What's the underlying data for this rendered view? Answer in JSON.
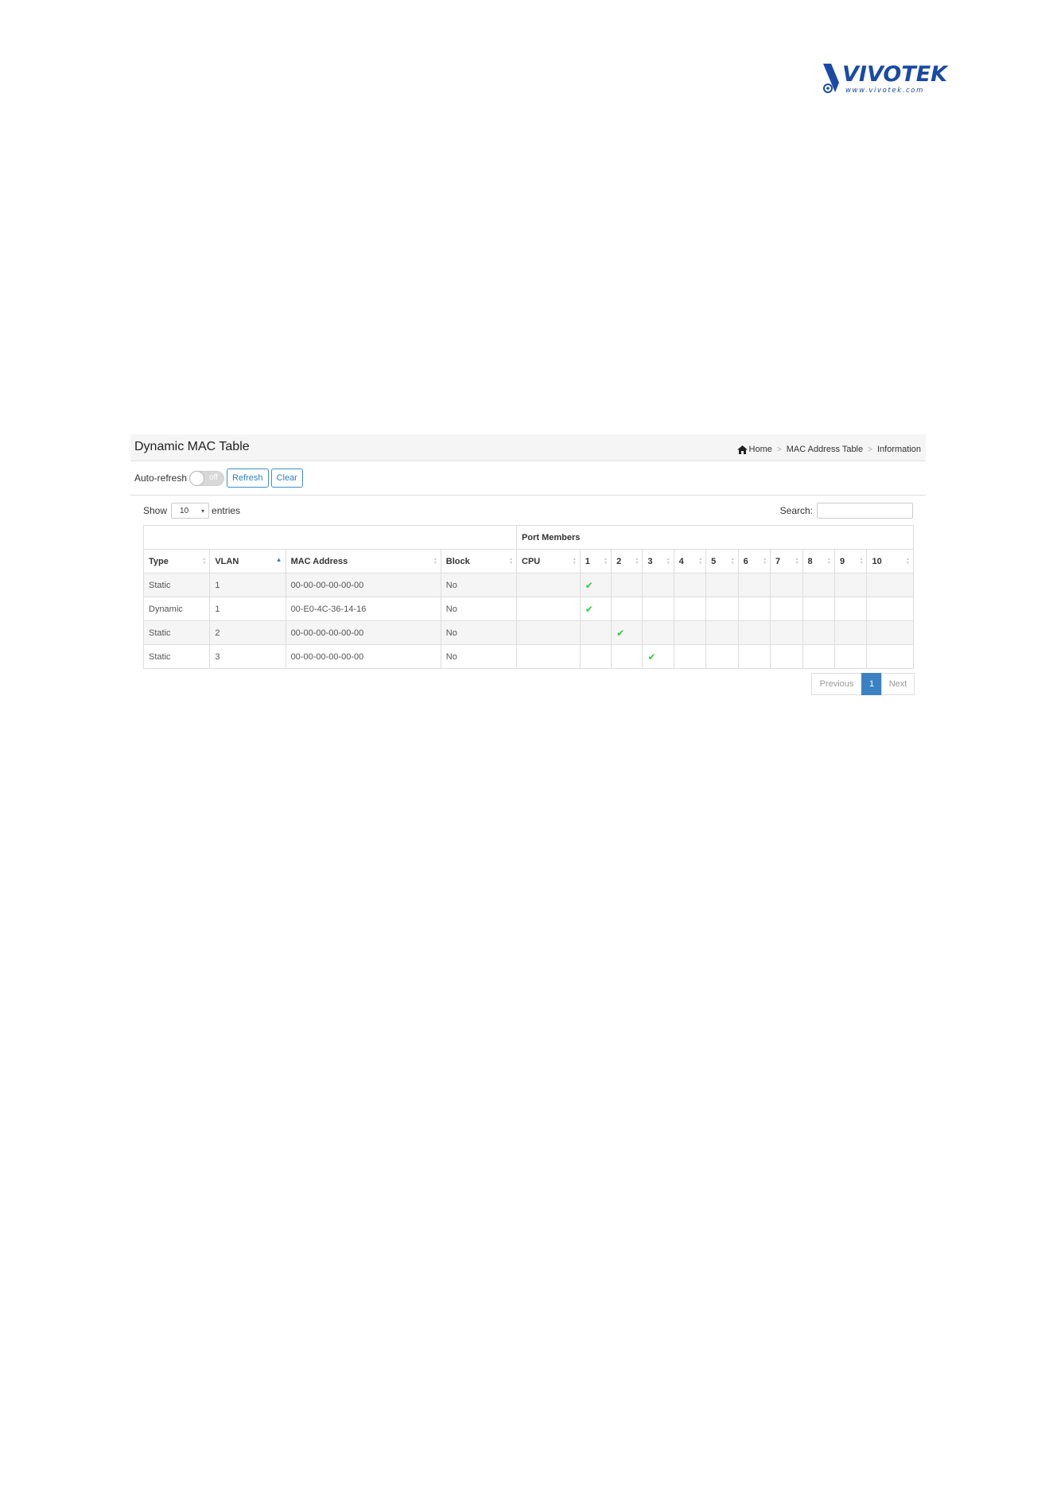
{
  "logo": {
    "word": "VIVOTEK",
    "url": "www.vivotek.com"
  },
  "header": {
    "title": "Dynamic MAC Table",
    "breadcrumb": [
      "Home",
      "MAC Address Table",
      "Information"
    ]
  },
  "toolbar": {
    "auto_refresh_label": "Auto-refresh",
    "toggle_state": "off",
    "refresh_label": "Refresh",
    "clear_label": "Clear"
  },
  "length_menu": {
    "show": "Show",
    "value": "10",
    "entries": "entries"
  },
  "search": {
    "label": "Search:",
    "value": ""
  },
  "table": {
    "group_header": "Port Members",
    "columns": [
      "Type",
      "VLAN",
      "MAC Address",
      "Block",
      "CPU",
      "1",
      "2",
      "3",
      "4",
      "5",
      "6",
      "7",
      "8",
      "9",
      "10"
    ],
    "sorted_column": "VLAN",
    "rows": [
      {
        "type": "Static",
        "vlan": "1",
        "mac": "00-00-00-00-00-00",
        "block": "No",
        "members": [
          "1"
        ]
      },
      {
        "type": "Dynamic",
        "vlan": "1",
        "mac": "00-E0-4C-36-14-16",
        "block": "No",
        "members": [
          "1"
        ]
      },
      {
        "type": "Static",
        "vlan": "2",
        "mac": "00-00-00-00-00-00",
        "block": "No",
        "members": [
          "2"
        ]
      },
      {
        "type": "Static",
        "vlan": "3",
        "mac": "00-00-00-00-00-00",
        "block": "No",
        "members": [
          "3"
        ]
      }
    ]
  },
  "pagination": {
    "previous": "Previous",
    "current": "1",
    "next": "Next"
  },
  "colors": {
    "accent": "#3b82c4",
    "check": "#2ecc40",
    "logo": "#1a4aa6"
  }
}
